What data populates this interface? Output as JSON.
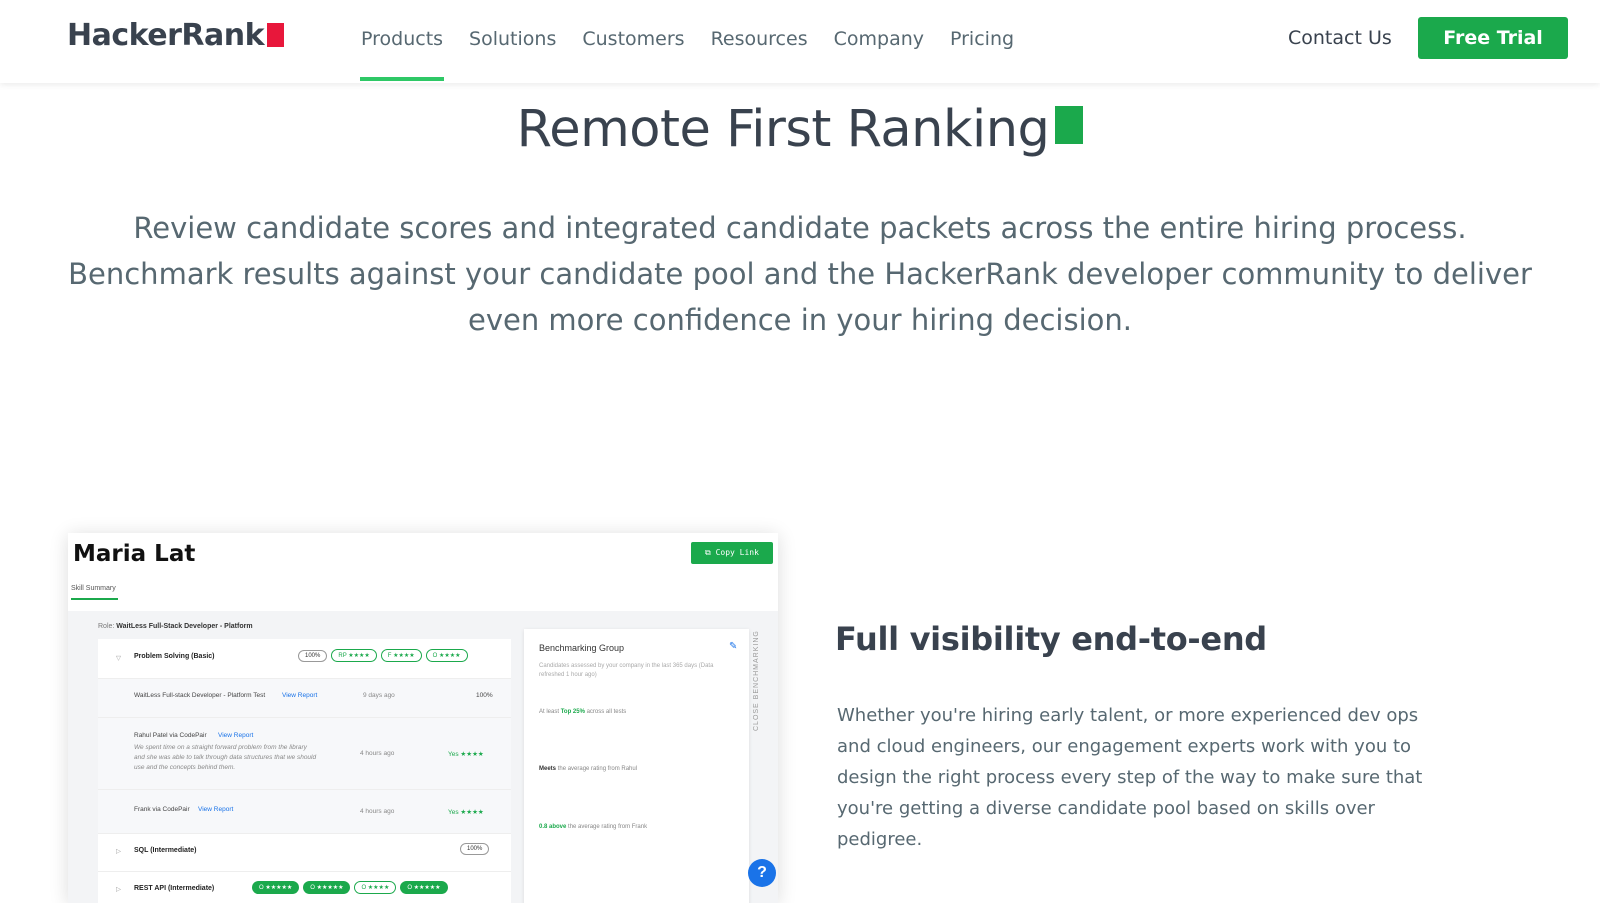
{
  "header": {
    "logo_text": "HackerRank",
    "nav": [
      "Products",
      "Solutions",
      "Customers",
      "Resources",
      "Company",
      "Pricing"
    ],
    "active_nav": "Products",
    "contact_label": "Contact Us",
    "trial_label": "Free Trial"
  },
  "hero": {
    "title": "Remote First Ranking",
    "description": "Review candidate scores and integrated candidate packets across the entire hiring process. Benchmark results against your candidate pool and the HackerRank developer community to deliver even more confidence in your hiring decision."
  },
  "card": {
    "candidate_name": "Maria Lat",
    "copy_link_label": "⧉ Copy Link",
    "tab_label": "Skill Summary",
    "role_prefix": "Role:",
    "role_name": "WaitLess Full-Stack Developer - Platform",
    "skills": [
      {
        "name": "Problem Solving (Basic)",
        "badges": [
          "100%",
          "RP ★★★★",
          "F ★★★★",
          "O ★★★★"
        ]
      },
      {
        "name": "SQL (Intermediate)",
        "badges": [
          "100%"
        ]
      },
      {
        "name": "REST API (Intermediate)",
        "badges": [
          "O ★★★★★",
          "O ★★★★★",
          "O ★★★★",
          "O ★★★★★"
        ]
      }
    ],
    "details": [
      {
        "text": "WaitLess Full-stack Developer - Platform Test",
        "link": "View Report",
        "time": "9 days ago",
        "score": "100%"
      },
      {
        "text": "Rahul Patel via CodePair",
        "link": "View Report",
        "note": "We spent time on a straight forward problem from the library and she was able to talk through data structures that we should use and the concepts behind them.",
        "time": "4 hours ago",
        "score": "Yes ★★★★"
      },
      {
        "text": "Frank via CodePair",
        "link": "View Report",
        "time": "4 hours ago",
        "score": "Yes ★★★★"
      }
    ],
    "benchmark": {
      "title": "Benchmarking Group",
      "subtitle": "Candidates assessed by your company in the last 365 days (Data refreshed 1 hour ago)",
      "line1_prefix": "At least",
      "line1_highlight": "Top 25%",
      "line1_suffix": "across all tests",
      "line2_highlight": "Meets",
      "line2_suffix": "the average rating from Rahul",
      "line3_highlight": "0.8 above",
      "line3_suffix": "the average rating from Frank"
    },
    "side_label": "CLOSE BENCHMARKING",
    "help_label": "?"
  },
  "feature": {
    "title": "Full visibility end-to-end",
    "description": "Whether you're hiring early talent, or more experienced dev ops and cloud engineers, our engagement experts work with you to design the right process every step of the way to make sure that you're getting a diverse candidate pool based on skills over pedigree."
  },
  "colors": {
    "brand_green": "#1ba94c",
    "logo_red": "#e8173b",
    "text_dark": "#39424e"
  }
}
